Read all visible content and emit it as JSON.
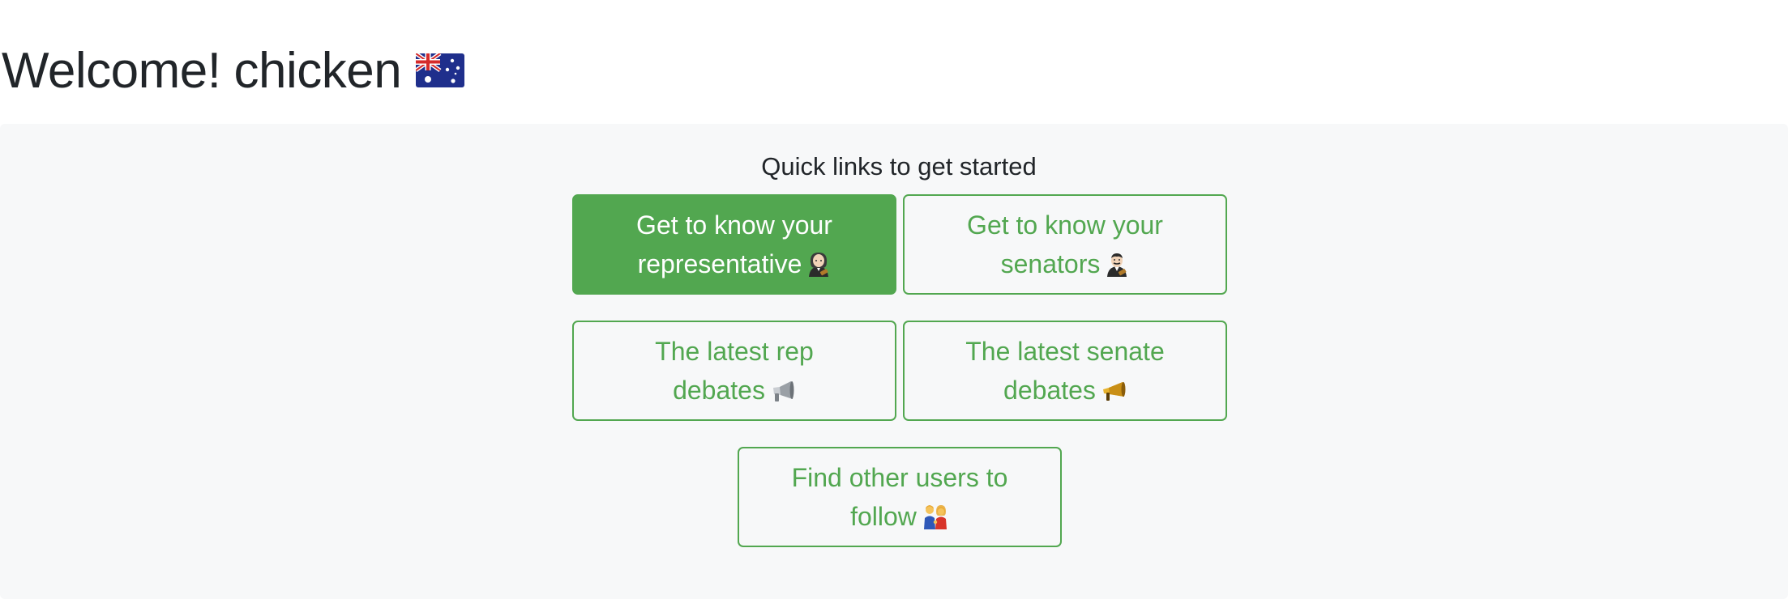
{
  "header": {
    "greeting": "Welcome!",
    "username": "chicken",
    "flag_icon": "australia-flag-icon"
  },
  "quick_links": {
    "title": "Quick links to get started",
    "accent_color": "#52a750",
    "buttons": [
      {
        "line1": "Get to know your",
        "line2": "representative",
        "icon": "woman-judge-icon",
        "style": "solid"
      },
      {
        "line1": "Get to know your",
        "line2": "senators",
        "icon": "man-judge-icon",
        "style": "outline"
      },
      {
        "line1": "The latest rep",
        "line2": "debates",
        "icon": "loudspeaker-icon",
        "style": "outline"
      },
      {
        "line1": "The latest senate",
        "line2": "debates",
        "icon": "megaphone-icon",
        "style": "outline"
      },
      {
        "line1": "Find other users to",
        "line2": "follow",
        "icon": "people-holding-hands-icon",
        "style": "outline"
      }
    ]
  }
}
